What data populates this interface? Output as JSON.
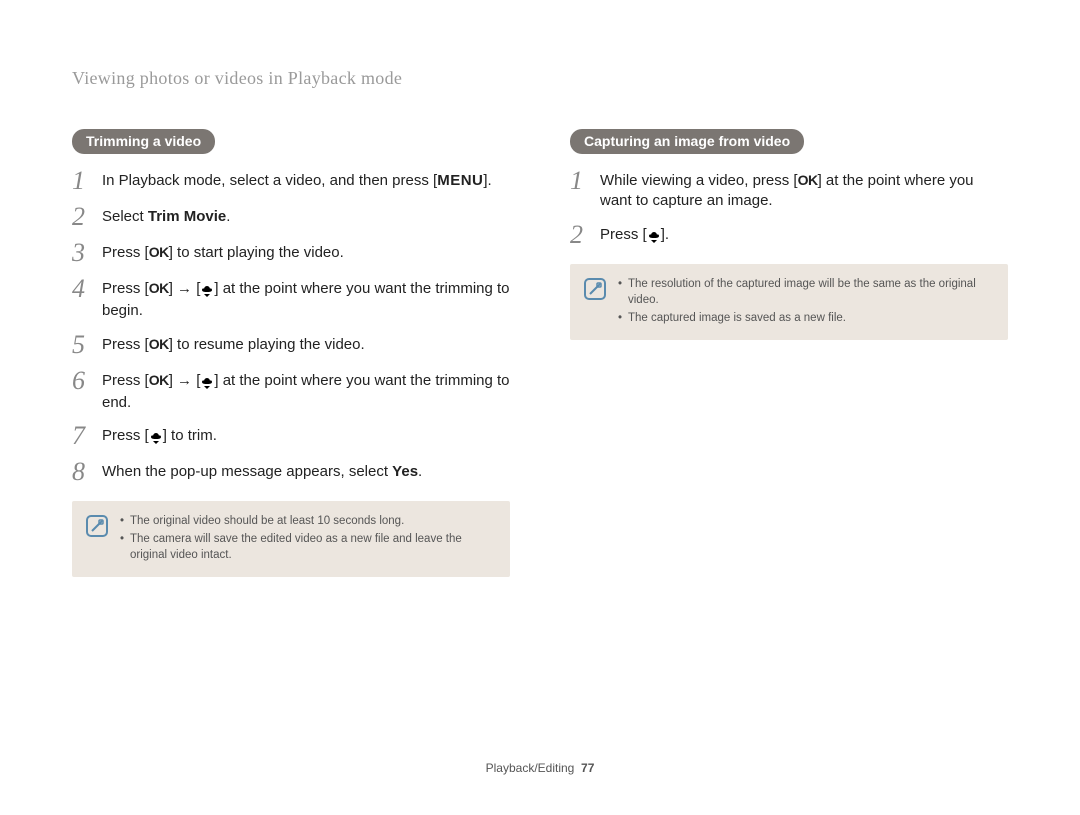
{
  "page_title": "Viewing photos or videos in Playback mode",
  "left": {
    "heading": "Trimming a video",
    "steps": [
      {
        "num": "1",
        "pre": "In Playback mode, select a video, and then press [",
        "btn": "MENU",
        "post": "]."
      },
      {
        "num": "2",
        "pre": "Select ",
        "bold": "Trim Movie",
        "post": "."
      },
      {
        "num": "3",
        "pre": "Press [",
        "icon": "ok",
        "post": "] to start playing the video."
      },
      {
        "num": "4",
        "pre": "Press [",
        "icon": "ok",
        "mid": "] → [",
        "icon2": "down",
        "post": "] at the point where you want the trimming to begin."
      },
      {
        "num": "5",
        "pre": "Press [",
        "icon": "ok",
        "post": "] to resume playing the video."
      },
      {
        "num": "6",
        "pre": "Press [",
        "icon": "ok",
        "mid": "] → [",
        "icon2": "down",
        "post": "] at the point where you want the trimming to end."
      },
      {
        "num": "7",
        "pre": "Press [",
        "icon": "down",
        "post": "] to trim."
      },
      {
        "num": "8",
        "pre": "When the pop-up message appears, select ",
        "bold": "Yes",
        "post": "."
      }
    ],
    "notes": [
      "The original video should be at least 10 seconds long.",
      "The camera will save the edited video as a new file and leave the original video intact."
    ]
  },
  "right": {
    "heading": "Capturing an image from video",
    "steps": [
      {
        "num": "1",
        "pre": "While viewing a video, press [",
        "icon": "ok",
        "post": "] at the point where you want to capture an image."
      },
      {
        "num": "2",
        "pre": "Press [",
        "icon": "down",
        "post": "]."
      }
    ],
    "notes": [
      "The resolution of the captured image will be the same as the original video.",
      "The captured image is saved as a new file."
    ]
  },
  "footer": {
    "section": "Playback/Editing",
    "page": "77"
  }
}
